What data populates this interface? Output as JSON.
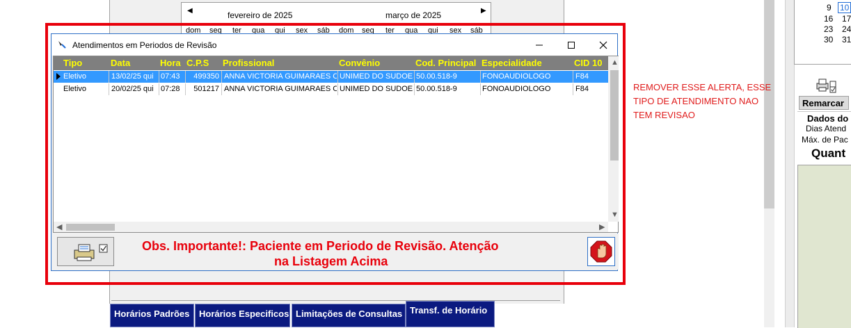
{
  "calendar": {
    "prev_icon": "chevron-left-icon",
    "next_icon": "chevron-right-icon",
    "month_left": "fevereiro de 2025",
    "month_right": "março de 2025",
    "weekdays": [
      "dom",
      "seg",
      "ter",
      "qua",
      "qui",
      "sex",
      "sáb"
    ]
  },
  "right_calendar": {
    "rows": [
      [
        "9",
        "10"
      ],
      [
        "16",
        "17"
      ],
      [
        "23",
        "24"
      ],
      [
        "30",
        "31"
      ]
    ],
    "today": "10"
  },
  "right_panel": {
    "remarcar_label": "Remarcar",
    "dados_label": "Dados do",
    "dias_label": "Dias Atend",
    "max_label": "Máx. de Pac",
    "quant_label": "Quant"
  },
  "annotation": {
    "lines": [
      "REMOVER ESSE ALERTA, ESSE",
      "TIPO DE ATENDIMENTO NAO",
      "TEM REVISAO"
    ],
    "color": "#e01b1b"
  },
  "dialog": {
    "title": "Atendimentos em Periodos de Revisão",
    "minimize_icon": "minimize-icon",
    "maximize_icon": "maximize-icon",
    "close_icon": "close-icon",
    "columns": [
      "Tipo",
      "Data",
      "Hora",
      "C.P.S",
      "Profissional",
      "Convênio",
      "Cod. Principal",
      "Especialidade",
      "CID 10"
    ],
    "rows": [
      [
        "Eletivo",
        "13/02/25 qui",
        "07:43",
        "499350",
        "ANNA VICTORIA GUIMARAES CA",
        "UNIMED DO SUDOEST",
        "50.00.518-9",
        "FONOAUDIOLOGO",
        "F84"
      ],
      [
        "Eletivo",
        "20/02/25 qui",
        "07:28",
        "501217",
        "ANNA VICTORIA GUIMARAES CA",
        "UNIMED DO SUDOEST",
        "50.00.518-9",
        "FONOAUDIOLOGO",
        "F84"
      ]
    ],
    "selected_row": 0,
    "obs_line1": "Obs. Importante!: Paciente em Periodo de Revisão. Atenção",
    "obs_line2": "na Listagem Acima",
    "print_icon": "printer-icon",
    "stop_icon": "stop-hand-icon",
    "header_color": "#7f7f7f",
    "header_text_color": "#ffff00",
    "alert_color": "#e8000b"
  },
  "bottom_tabs": [
    "Horários Padrões",
    "Horários Especificos",
    "Limitações de Consultas",
    "Transf. de Horário"
  ]
}
